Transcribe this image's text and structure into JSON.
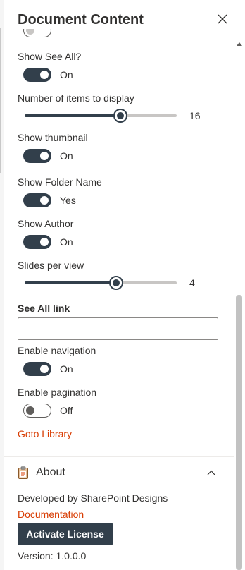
{
  "panel": {
    "title": "Document Content"
  },
  "settings": {
    "show_see_all": {
      "label": "Show See All?",
      "state": "On"
    },
    "items_to_display": {
      "label": "Number of items to display",
      "value": "16",
      "fraction": 0.63
    },
    "show_thumbnail": {
      "label": "Show thumbnail",
      "state": "On"
    },
    "show_folder_name": {
      "label": "Show Folder Name",
      "state": "Yes"
    },
    "show_author": {
      "label": "Show Author",
      "state": "On"
    },
    "slides_per_view": {
      "label": "Slides per view",
      "value": "4",
      "fraction": 0.6
    },
    "see_all_link": {
      "label": "See All link",
      "value": ""
    },
    "enable_navigation": {
      "label": "Enable navigation",
      "state": "On"
    },
    "enable_pagination": {
      "label": "Enable pagination",
      "state": "Off"
    },
    "goto_library": "Goto Library"
  },
  "about": {
    "title": "About",
    "developed_by": "Developed by SharePoint Designs",
    "documentation": "Documentation",
    "activate_button": "Activate License",
    "version": "Version: 1.0.0.0"
  },
  "colors": {
    "accent": "#323f4b",
    "link": "#d83b01",
    "text": "#323130"
  },
  "icons": {
    "close": "close-icon",
    "about": "clipboard-icon",
    "collapse": "chevron-up-icon",
    "scroll": "scroll-up-arrow-icon"
  }
}
